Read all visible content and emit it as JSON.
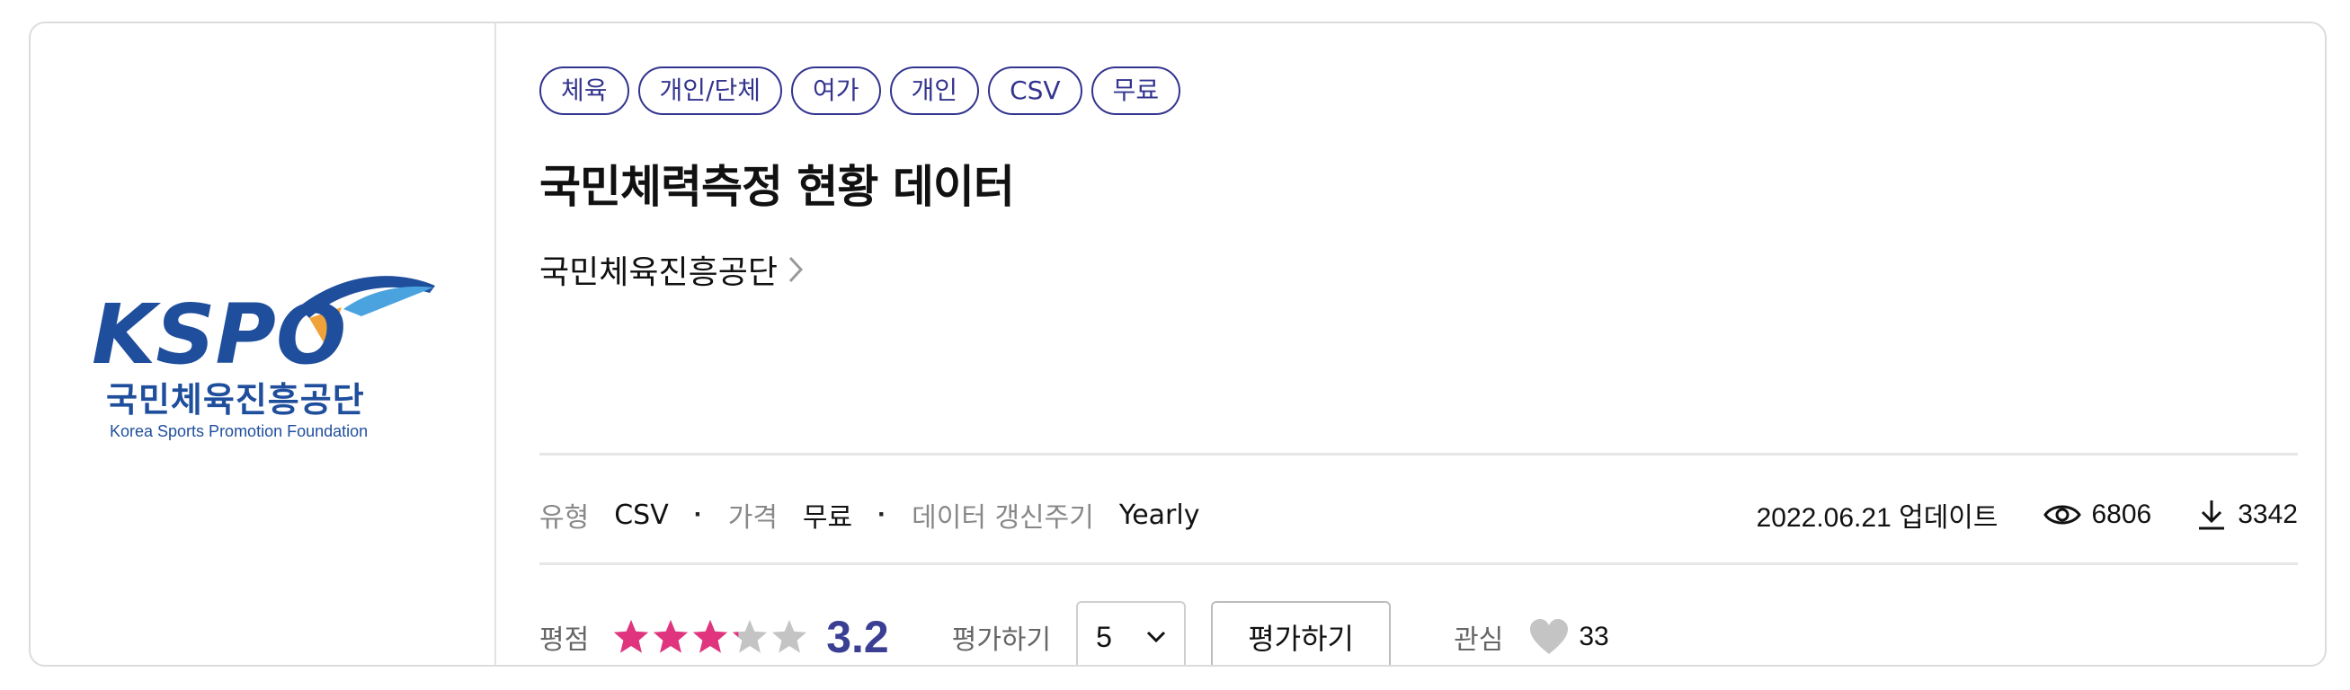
{
  "logo": {
    "brand": "KSPO",
    "org_name_ko": "국민체육진흥공단",
    "org_name_en": "Korea Sports Promotion Foundation"
  },
  "tags": [
    "체육",
    "개인/단체",
    "여가",
    "개인",
    "CSV",
    "무료"
  ],
  "title": "국민체력측정 현황 데이터",
  "provider": "국민체육진흥공단",
  "meta": {
    "type_label": "유형",
    "type_value": "CSV",
    "price_label": "가격",
    "price_value": "무료",
    "cycle_label": "데이터 갱신주기",
    "cycle_value": "Yearly",
    "updated": "2022.06.21 업데이트",
    "views": "6806",
    "downloads": "3342"
  },
  "rating": {
    "label": "평점",
    "score": "3.2",
    "stars_value": 3.2,
    "stars_max": 5,
    "action_label": "평가하기",
    "select_value": "5",
    "button_label": "평가하기",
    "interest_label": "관심",
    "interest_count": "33"
  },
  "colors": {
    "tag_border": "#33348e",
    "star_filled": "#e0357e",
    "star_empty": "#c4c4c4",
    "score": "#3b3f94",
    "heart": "#c4c4c4"
  }
}
